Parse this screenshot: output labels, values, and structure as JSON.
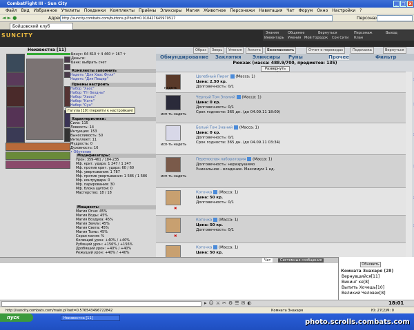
{
  "window": {
    "title": "CombatFight III - Sun City"
  },
  "menu": [
    "Файл",
    "Вид",
    "Избранное",
    "Утилиты",
    "Поединки",
    "Комплекты",
    "Приёмы",
    "Эликсиры",
    "Магия",
    "Животное",
    "Персонажи",
    "Навигация",
    "Чат",
    "Форум",
    "Окно",
    "Настройки",
    "?"
  ],
  "address": {
    "label": "Адрес",
    "url": "http://suncity.combats.com/buttons.pl?batt=0.010427645970517",
    "search_label": "Персонаж"
  },
  "tab": {
    "label": "Бойцовский клуб"
  },
  "game": {
    "logo": "SUNCITY",
    "top_nav": [
      "Знания",
      "Общение",
      "Вернуться",
      "Персонаж",
      "Выход",
      "Инвентарь",
      "Умения",
      "Мой Городок",
      "Сон Сити",
      "Клан"
    ],
    "sub_tabs": [
      "Образ",
      "Зверь",
      "Умения",
      "Анкета",
      "Безопасность",
      "Отчет о переводах",
      "Подсказка",
      "Вернуться"
    ],
    "categories": [
      "Обмундирование",
      "Заклятия",
      "Эликсиры",
      "Руны",
      "Прочее",
      "Фильтр"
    ],
    "bag_title": "Рюкзак (масса: 488.9/700, предметов: 135)",
    "sort_button": "Развернуть всё"
  },
  "character": {
    "name": "Неизвестна [11]",
    "stats": [
      "Бонус: 64 810 ☥  4 460 ☥  167 ☥",
      "Деньги:",
      "Банк: выбрать счет"
    ],
    "sets_header": "Комплекты   запомнить",
    "sets": [
      "Надеть \"Для Хаос Фулл\"",
      "Надеть \"Для Пещер\""
    ],
    "tricks_header": "Приемы   настроить",
    "tricks": [
      "Набор \"Хаос\"",
      "Набор \"Пт бездны\"",
      "Набор \"Хаосс\"",
      "Набор \"Катк\"",
      "Набор \"Сун\""
    ],
    "tooltip": "Гагула [10] (перейти к настройкам)",
    "chars_header": "Характеристики:",
    "chars": [
      "Сила: 115",
      "Ловкость: 14",
      "Интуиция: 153",
      "Выносливость: 50",
      "Интеллект: 11",
      "Мудрость: 0",
      "Духовность: 16",
      "• Обучение"
    ],
    "mods_header": "Модификаторы:",
    "mods": [
      "Урон: 359-461 / 184-235",
      "Мф. крит. удара: 1 247 / 1 247",
      "Мф. против крит. удара: 60 / 60",
      "Мф. увертывания: 1 787",
      "Мф. против увертывания: 1 586 / 1 586",
      "Мф. контрудара: 0",
      "Мф. парирования: 30",
      "Мф. блока щитом: 0",
      "Мастерство: 18 / 18"
    ],
    "power_header": "Мощность:",
    "power": [
      "Магия Огня: 45%",
      "Магия Воды: 45%",
      "Магия Воздуха: 45%",
      "Магия Земли: 45%",
      "Магия Света: 45%",
      "Магия Тьмы: 45%",
      "Серая магия: %",
      "Колющий урон: +40% / +40%",
      "Рубящий урон: +156% / +156%",
      "Дробящий урон: +40% / +40%",
      "Режущий урон: +40% / +40%"
    ]
  },
  "items": [
    {
      "name": "Целебный Пирог",
      "mass": "(Масса: 1)",
      "price": "Цена: 2.50 кр.",
      "dur": "Долговечность: 0/1",
      "extra": "",
      "btn": "надеть"
    },
    {
      "name": "Черный Том Знаний",
      "mass": "(Масса: 1)",
      "price": "Цена: 0 кр.",
      "dur": "Долговечность: 0/1",
      "extra": "Срок годности: 365 дн. (до 04.09.11 18:09)",
      "btn": "исп-ть надеть"
    },
    {
      "name": "Белый Том Знаний",
      "mass": "(Масса: 1)",
      "price": "Цена: 0 кр.",
      "dur": "Долговечность: 0/1",
      "extra": "Срок годности: 365 дн. (до 04.09.11 03:34)",
      "btn": "исп-ть надеть"
    },
    {
      "name": "Переносная лаборатория",
      "mass": "(Масса: 1)",
      "price": "Долговечность: неразрушимо",
      "dur": "Уникальное - владение. Максимум 1 ед.",
      "extra": "",
      "btn": "исп-ть надеть"
    },
    {
      "name": "Коточка",
      "mass": "(Масса: 1)",
      "price": "Цена: 50 кр.",
      "dur": "Долговечность: 0/1",
      "extra": "",
      "btn": ""
    },
    {
      "name": "Коточка",
      "mass": "(Масса: 1)",
      "price": "Цена: 50 кр.",
      "dur": "Долговечность: 0/1",
      "extra": "",
      "btn": ""
    },
    {
      "name": "Коточка",
      "mass": "(Масса: 1)",
      "price": "Цена: 50 кр.",
      "dur": "Долговечность: 0/1",
      "extra": "",
      "btn": ""
    }
  ],
  "chat": {
    "tab_chat": "Чат",
    "tab_sys": "Системные сообщения"
  },
  "room": {
    "refresh": "Обновить",
    "title": "Комната Знахаря (28)",
    "people": [
      "Вернувшийся[11]",
      "Викинг ке[8]",
      "Выпить Хочешь[10]",
      "Великий Человек[8]"
    ]
  },
  "input": {
    "clock": "18:01"
  },
  "status": {
    "url": "http://suncity.combats.com/main.pl?set=0.576543496722842",
    "room": "Комната Знахаря",
    "ping": "Ю: 27(2)М: 0"
  },
  "taskbar": {
    "start": "пуск",
    "item": "Неизвестна [11]"
  },
  "watermark": "photo.scrolls.combats.com"
}
